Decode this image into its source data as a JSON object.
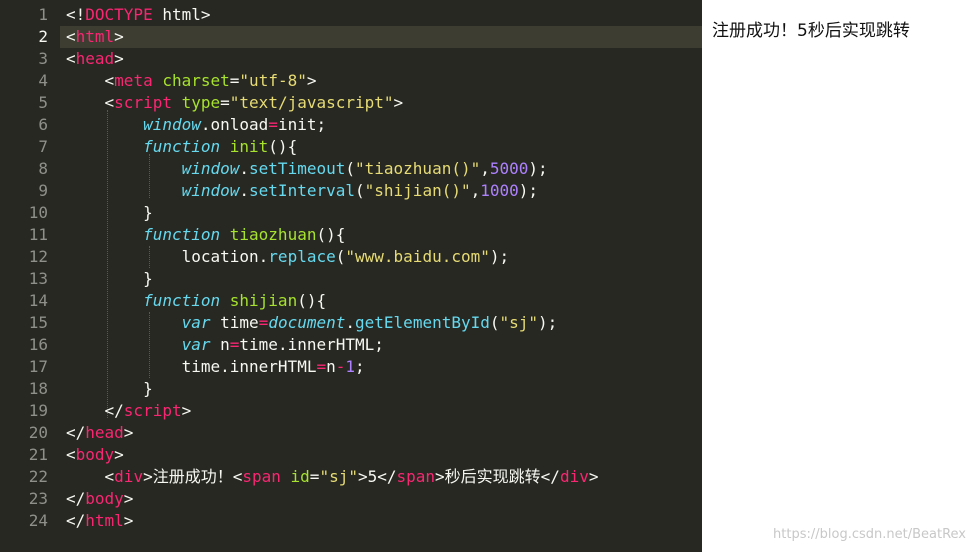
{
  "editor": {
    "line_numbers": [
      "1",
      "2",
      "3",
      "4",
      "5",
      "6",
      "7",
      "8",
      "9",
      "10",
      "11",
      "12",
      "13",
      "14",
      "15",
      "16",
      "17",
      "18",
      "19",
      "20",
      "21",
      "22",
      "23",
      "24"
    ],
    "active_line": "2",
    "lines": [
      [
        [
          "t-txt",
          "<!"
        ],
        [
          "t-tag",
          "DOCTYPE"
        ],
        [
          "t-txt",
          " html>"
        ]
      ],
      [
        [
          "t-txt",
          "<"
        ],
        [
          "t-tag",
          "html"
        ],
        [
          "t-txt",
          ">"
        ]
      ],
      [
        [
          "t-txt",
          "<"
        ],
        [
          "t-tag",
          "head"
        ],
        [
          "t-txt",
          ">"
        ]
      ],
      [
        [
          "t-txt",
          "    <"
        ],
        [
          "t-tag",
          "meta"
        ],
        [
          "t-txt",
          " "
        ],
        [
          "t-attr",
          "charset"
        ],
        [
          "t-txt",
          "="
        ],
        [
          "t-str",
          "\"utf-8\""
        ],
        [
          "t-txt",
          ">"
        ]
      ],
      [
        [
          "t-txt",
          "    <"
        ],
        [
          "t-tag",
          "script"
        ],
        [
          "t-txt",
          " "
        ],
        [
          "t-attr",
          "type"
        ],
        [
          "t-txt",
          "="
        ],
        [
          "t-str",
          "\"text/javascript\""
        ],
        [
          "t-txt",
          ">"
        ]
      ],
      [
        [
          "t-txt",
          "        "
        ],
        [
          "t-obj",
          "window"
        ],
        [
          "t-txt",
          ".onload"
        ],
        [
          "t-op",
          "="
        ],
        [
          "t-txt",
          "init;"
        ]
      ],
      [
        [
          "t-txt",
          "        "
        ],
        [
          "t-kw",
          "function"
        ],
        [
          "t-txt",
          " "
        ],
        [
          "t-fn",
          "init"
        ],
        [
          "t-txt",
          "(){"
        ]
      ],
      [
        [
          "t-txt",
          "            "
        ],
        [
          "t-obj",
          "window"
        ],
        [
          "t-txt",
          "."
        ],
        [
          "t-call",
          "setTimeout"
        ],
        [
          "t-txt",
          "("
        ],
        [
          "t-str",
          "\"tiaozhuan()\""
        ],
        [
          "t-txt",
          ","
        ],
        [
          "t-num",
          "5000"
        ],
        [
          "t-txt",
          ");"
        ]
      ],
      [
        [
          "t-txt",
          "            "
        ],
        [
          "t-obj",
          "window"
        ],
        [
          "t-txt",
          "."
        ],
        [
          "t-call",
          "setInterval"
        ],
        [
          "t-txt",
          "("
        ],
        [
          "t-str",
          "\"shijian()\""
        ],
        [
          "t-txt",
          ","
        ],
        [
          "t-num",
          "1000"
        ],
        [
          "t-txt",
          ");"
        ]
      ],
      [
        [
          "t-txt",
          "        }"
        ]
      ],
      [
        [
          "t-txt",
          "        "
        ],
        [
          "t-kw",
          "function"
        ],
        [
          "t-txt",
          " "
        ],
        [
          "t-fn",
          "tiaozhuan"
        ],
        [
          "t-txt",
          "(){"
        ]
      ],
      [
        [
          "t-txt",
          "            location."
        ],
        [
          "t-call",
          "replace"
        ],
        [
          "t-txt",
          "("
        ],
        [
          "t-str",
          "\"www.baidu.com\""
        ],
        [
          "t-txt",
          ");"
        ]
      ],
      [
        [
          "t-txt",
          "        }"
        ]
      ],
      [
        [
          "t-txt",
          "        "
        ],
        [
          "t-kw",
          "function"
        ],
        [
          "t-txt",
          " "
        ],
        [
          "t-fn",
          "shijian"
        ],
        [
          "t-txt",
          "(){"
        ]
      ],
      [
        [
          "t-txt",
          "            "
        ],
        [
          "t-kw",
          "var"
        ],
        [
          "t-txt",
          " time"
        ],
        [
          "t-op",
          "="
        ],
        [
          "t-obj",
          "document"
        ],
        [
          "t-txt",
          "."
        ],
        [
          "t-call",
          "getElementById"
        ],
        [
          "t-txt",
          "("
        ],
        [
          "t-str",
          "\"sj\""
        ],
        [
          "t-txt",
          ");"
        ]
      ],
      [
        [
          "t-txt",
          "            "
        ],
        [
          "t-kw",
          "var"
        ],
        [
          "t-txt",
          " n"
        ],
        [
          "t-op",
          "="
        ],
        [
          "t-txt",
          "time.innerHTML;"
        ]
      ],
      [
        [
          "t-txt",
          "            time.innerHTML"
        ],
        [
          "t-op",
          "="
        ],
        [
          "t-txt",
          "n"
        ],
        [
          "t-op",
          "-"
        ],
        [
          "t-num",
          "1"
        ],
        [
          "t-txt",
          ";"
        ]
      ],
      [
        [
          "t-txt",
          "        }"
        ]
      ],
      [
        [
          "t-txt",
          "    </"
        ],
        [
          "t-tag",
          "script"
        ],
        [
          "t-txt",
          ">"
        ]
      ],
      [
        [
          "t-txt",
          "</"
        ],
        [
          "t-tag",
          "head"
        ],
        [
          "t-txt",
          ">"
        ]
      ],
      [
        [
          "t-txt",
          "<"
        ],
        [
          "t-tag",
          "body"
        ],
        [
          "t-txt",
          ">"
        ]
      ],
      [
        [
          "t-txt",
          "    <"
        ],
        [
          "t-tag",
          "div"
        ],
        [
          "t-txt",
          ">注册成功！<"
        ],
        [
          "t-tag",
          "span"
        ],
        [
          "t-txt",
          " "
        ],
        [
          "t-attr",
          "id"
        ],
        [
          "t-txt",
          "="
        ],
        [
          "t-str",
          "\"sj\""
        ],
        [
          "t-txt",
          ">5</"
        ],
        [
          "t-tag",
          "span"
        ],
        [
          "t-txt",
          ">秒后实现跳转</"
        ],
        [
          "t-tag",
          "div"
        ],
        [
          "t-txt",
          ">"
        ]
      ],
      [
        [
          "t-txt",
          "</"
        ],
        [
          "t-tag",
          "body"
        ],
        [
          "t-txt",
          ">"
        ]
      ],
      [
        [
          "t-txt",
          "</"
        ],
        [
          "t-tag",
          "html"
        ],
        [
          "t-txt",
          ">"
        ]
      ]
    ]
  },
  "preview": {
    "message": "注册成功！5秒后实现跳转"
  },
  "watermark": "https://blog.csdn.net/BeatRex"
}
